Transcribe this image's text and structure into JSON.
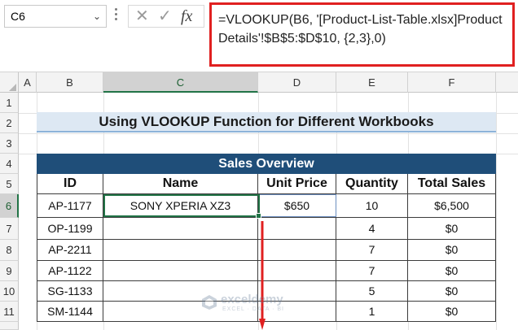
{
  "formula_bar": {
    "name_box": "C6",
    "cancel_glyph": "✕",
    "enter_glyph": "✓",
    "fx_label": "fx",
    "formula": "=VLOOKUP(B6, '[Product-List-Table.xlsx]Product Details'!$B$5:$D$10, {2,3},0)"
  },
  "columns": [
    "A",
    "B",
    "C",
    "D",
    "E",
    "F"
  ],
  "rows": [
    "1",
    "2",
    "3",
    "4",
    "5",
    "6",
    "7",
    "8",
    "9",
    "10",
    "11"
  ],
  "selected_column": "C",
  "selected_row": "6",
  "title": "Using VLOOKUP Function for Different Workbooks",
  "table": {
    "caption": "Sales Overview",
    "headers": [
      "ID",
      "Name",
      "Unit Price",
      "Quantity",
      "Total Sales"
    ],
    "rows": [
      [
        "AP-1177",
        "SONY XPERIA XZ3",
        "$650",
        "10",
        "$6,500"
      ],
      [
        "OP-1199",
        "",
        "",
        "4",
        "$0"
      ],
      [
        "AP-2211",
        "",
        "",
        "7",
        "$0"
      ],
      [
        "AP-1122",
        "",
        "",
        "7",
        "$0"
      ],
      [
        "SG-1133",
        "",
        "",
        "5",
        "$0"
      ],
      [
        "SM-1144",
        "",
        "",
        "1",
        "$0"
      ]
    ]
  },
  "watermark": {
    "name": "exceldemy",
    "tagline": "EXCEL · DATA · BI"
  },
  "colors": {
    "header_fill": "#1f4e79",
    "title_fill": "#dde8f3",
    "highlight_border": "#e02020",
    "selection": "#217346",
    "drag_arrow": "#e02020"
  }
}
